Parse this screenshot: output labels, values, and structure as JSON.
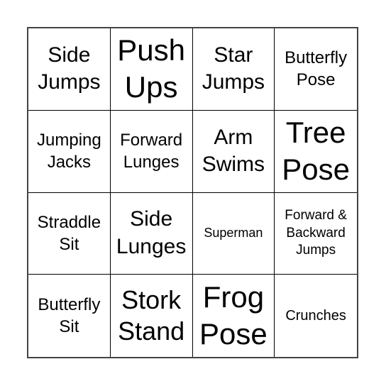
{
  "card": {
    "cells": [
      [
        "Side\nJumps",
        "Push\nUps",
        "Star\nJumps",
        "Butterfly\nPose"
      ],
      [
        "Jumping\nJacks",
        "Forward\nLunges",
        "Arm\nSwims",
        "Tree\nPose"
      ],
      [
        "Straddle\nSit",
        "Side\nLunges",
        "Superman",
        "Forward &\nBackward\nJumps"
      ],
      [
        "Butterfly\nSit",
        "Stork\nStand",
        "Frog\nPose",
        "Crunches"
      ]
    ]
  }
}
